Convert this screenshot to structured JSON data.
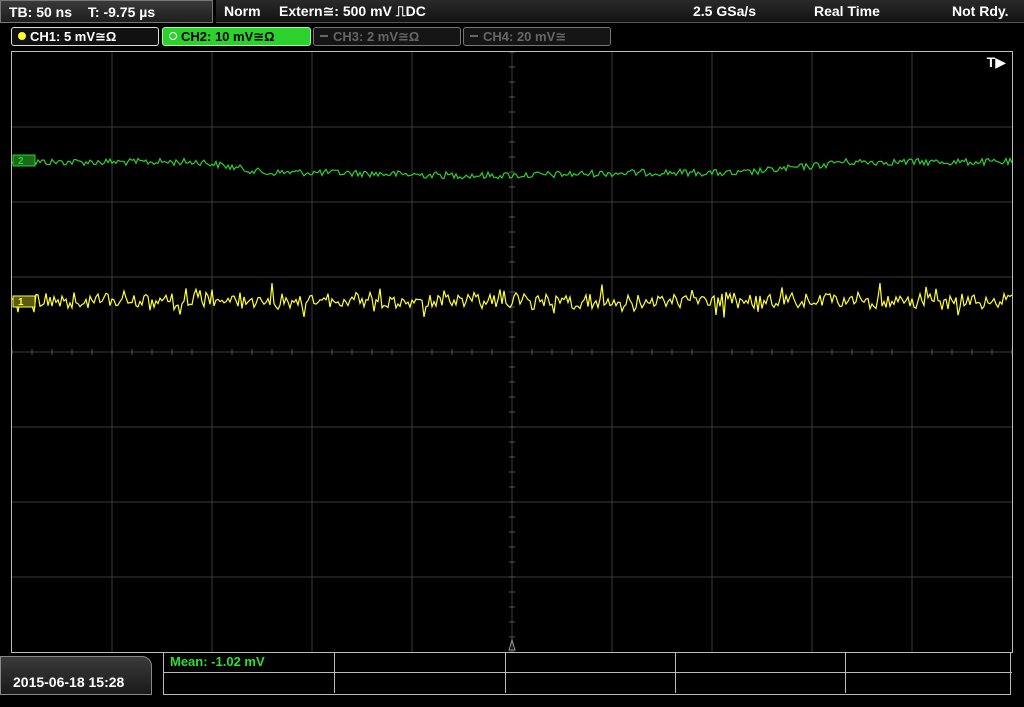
{
  "status": {
    "timebase": "TB: 50 ns",
    "time_offset": "T: -9.75 µs",
    "mode": "Norm",
    "trigger": "Extern≅: 500 mV ⎍DC",
    "sample_rate": "2.5 GSa/s",
    "acquisition": "Real Time",
    "state": "Not Rdy."
  },
  "channels": [
    {
      "label": "CH1: 5 mV≅Ω",
      "color": "#ffff30",
      "active": true
    },
    {
      "label": "CH2: 10 mV≅Ω",
      "color": "#2dd12d",
      "active": true
    },
    {
      "label": "CH3: 2 mV≅Ω",
      "color": "#666666",
      "active": false
    },
    {
      "label": "CH4: 20 mV≅",
      "color": "#666666",
      "active": false
    }
  ],
  "screen": {
    "trigger_marker": "T▶",
    "grid_divisions": {
      "x": 10,
      "y": 8
    }
  },
  "traces": {
    "ch1": {
      "color": "#ffff30",
      "marker": "1"
    },
    "ch2": {
      "color": "#2dd12d",
      "marker": "2"
    }
  },
  "measurement": {
    "mean": "Mean: -1.02 mV"
  },
  "datetime": "2015-06-18 15:28"
}
